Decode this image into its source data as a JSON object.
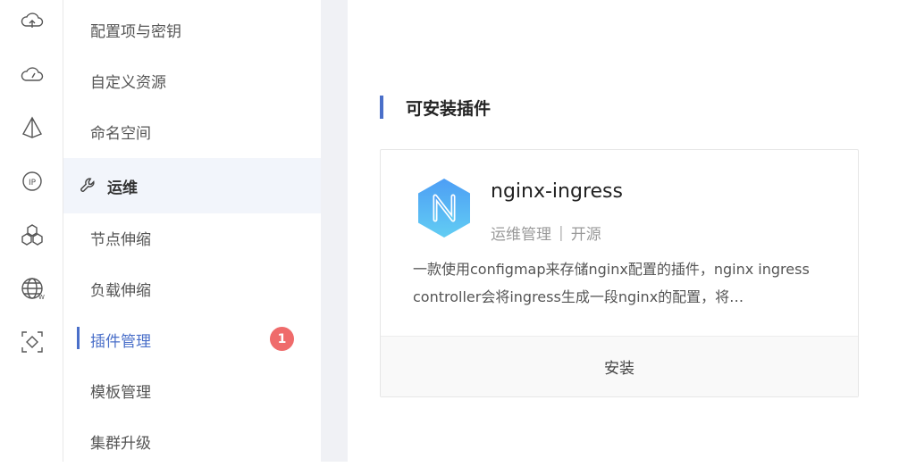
{
  "rail": {
    "icons": [
      "cloud-upload-icon",
      "cloud-gauge-icon",
      "pyramid-icon",
      "ip-icon",
      "cluster-icon",
      "globe-icon",
      "scan-icon"
    ]
  },
  "subnav": {
    "items_top": [
      "配置项与密钥",
      "自定义资源",
      "命名空间"
    ],
    "group_label": "运维",
    "group_icon": "wrench-icon",
    "items_ops": [
      "节点伸缩",
      "负载伸缩",
      "插件管理",
      "模板管理",
      "集群升级"
    ],
    "active_item": "插件管理",
    "badge_count": "1"
  },
  "main": {
    "section_title": "可安装插件",
    "plugin": {
      "name": "nginx-ingress",
      "tag1": "运维管理",
      "tag_separator": "|",
      "tag2": "开源",
      "description": "一款使用configmap来存储nginx配置的插件，nginx ingress controller会将ingress生成一段nginx的配置，将…",
      "install_label": "安装"
    }
  },
  "colors": {
    "accent": "#4a6fc9",
    "badge": "#ef6b6b",
    "logo_gradient_top": "#5aa8f5",
    "logo_gradient_bottom": "#5cc8f2"
  }
}
